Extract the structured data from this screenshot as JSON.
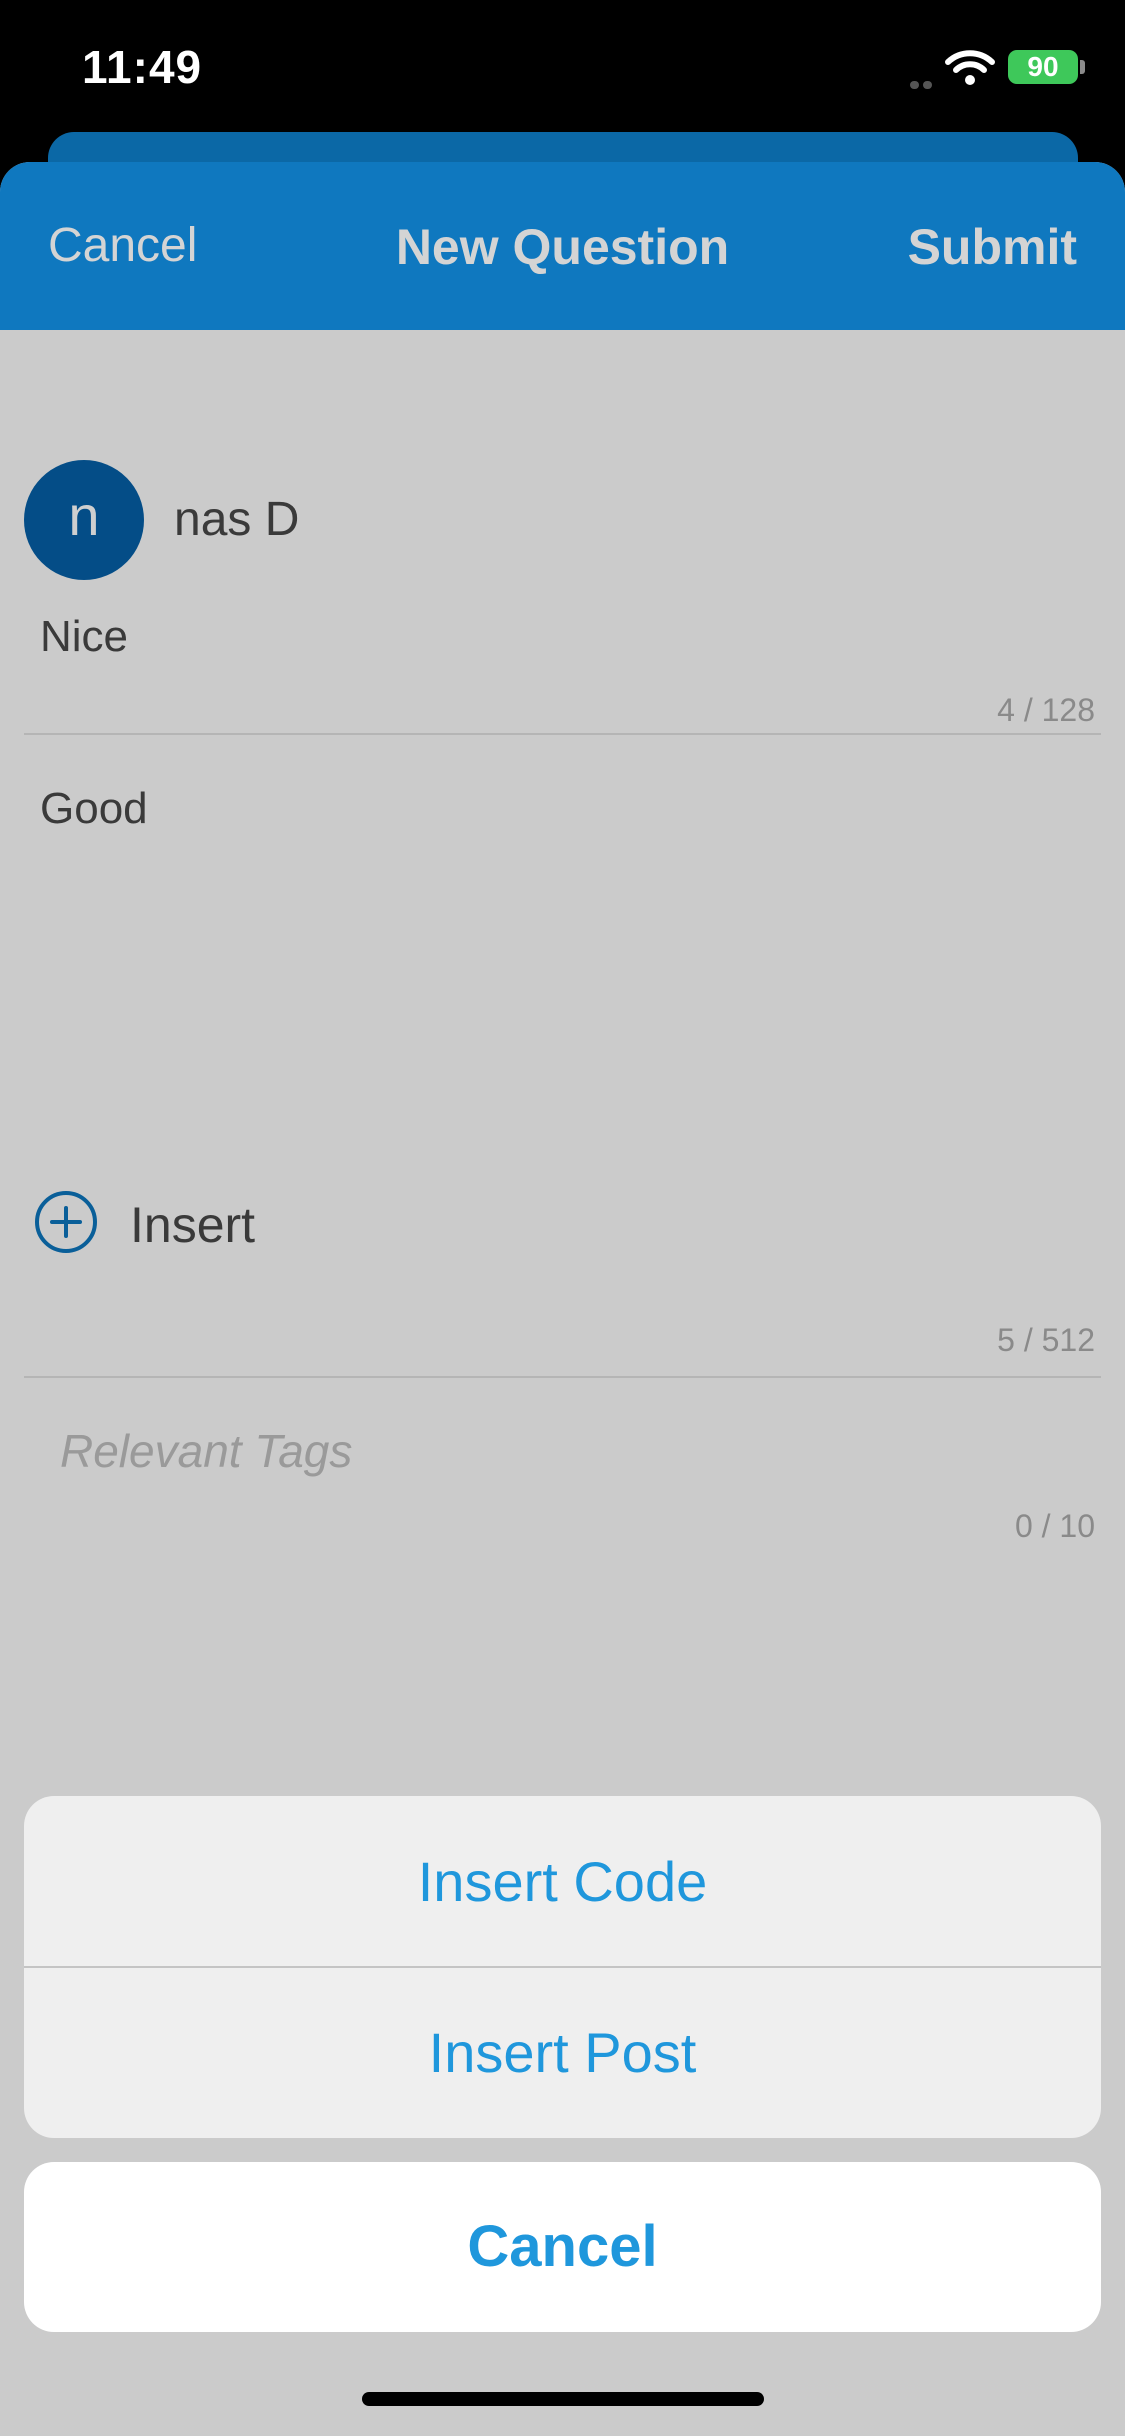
{
  "status_bar": {
    "time": "11:49",
    "battery": "90"
  },
  "nav": {
    "cancel_label": "Cancel",
    "title": "New Question",
    "submit_label": "Submit"
  },
  "author": {
    "avatar_letter": "n",
    "name": "nas D"
  },
  "question": {
    "title_value": "Nice",
    "title_count": "4 / 128",
    "body_value": "Good",
    "insert_label": "Insert",
    "body_count": "5 / 512",
    "tags_placeholder": "Relevant Tags",
    "tags_count": "0 / 10"
  },
  "action_sheet": {
    "items": [
      "Insert Code",
      "Insert Post"
    ],
    "cancel_label": "Cancel"
  },
  "colors": {
    "accent": "#1f97dc",
    "nav_bar": "#0f78bf",
    "avatar": "#044d87"
  }
}
